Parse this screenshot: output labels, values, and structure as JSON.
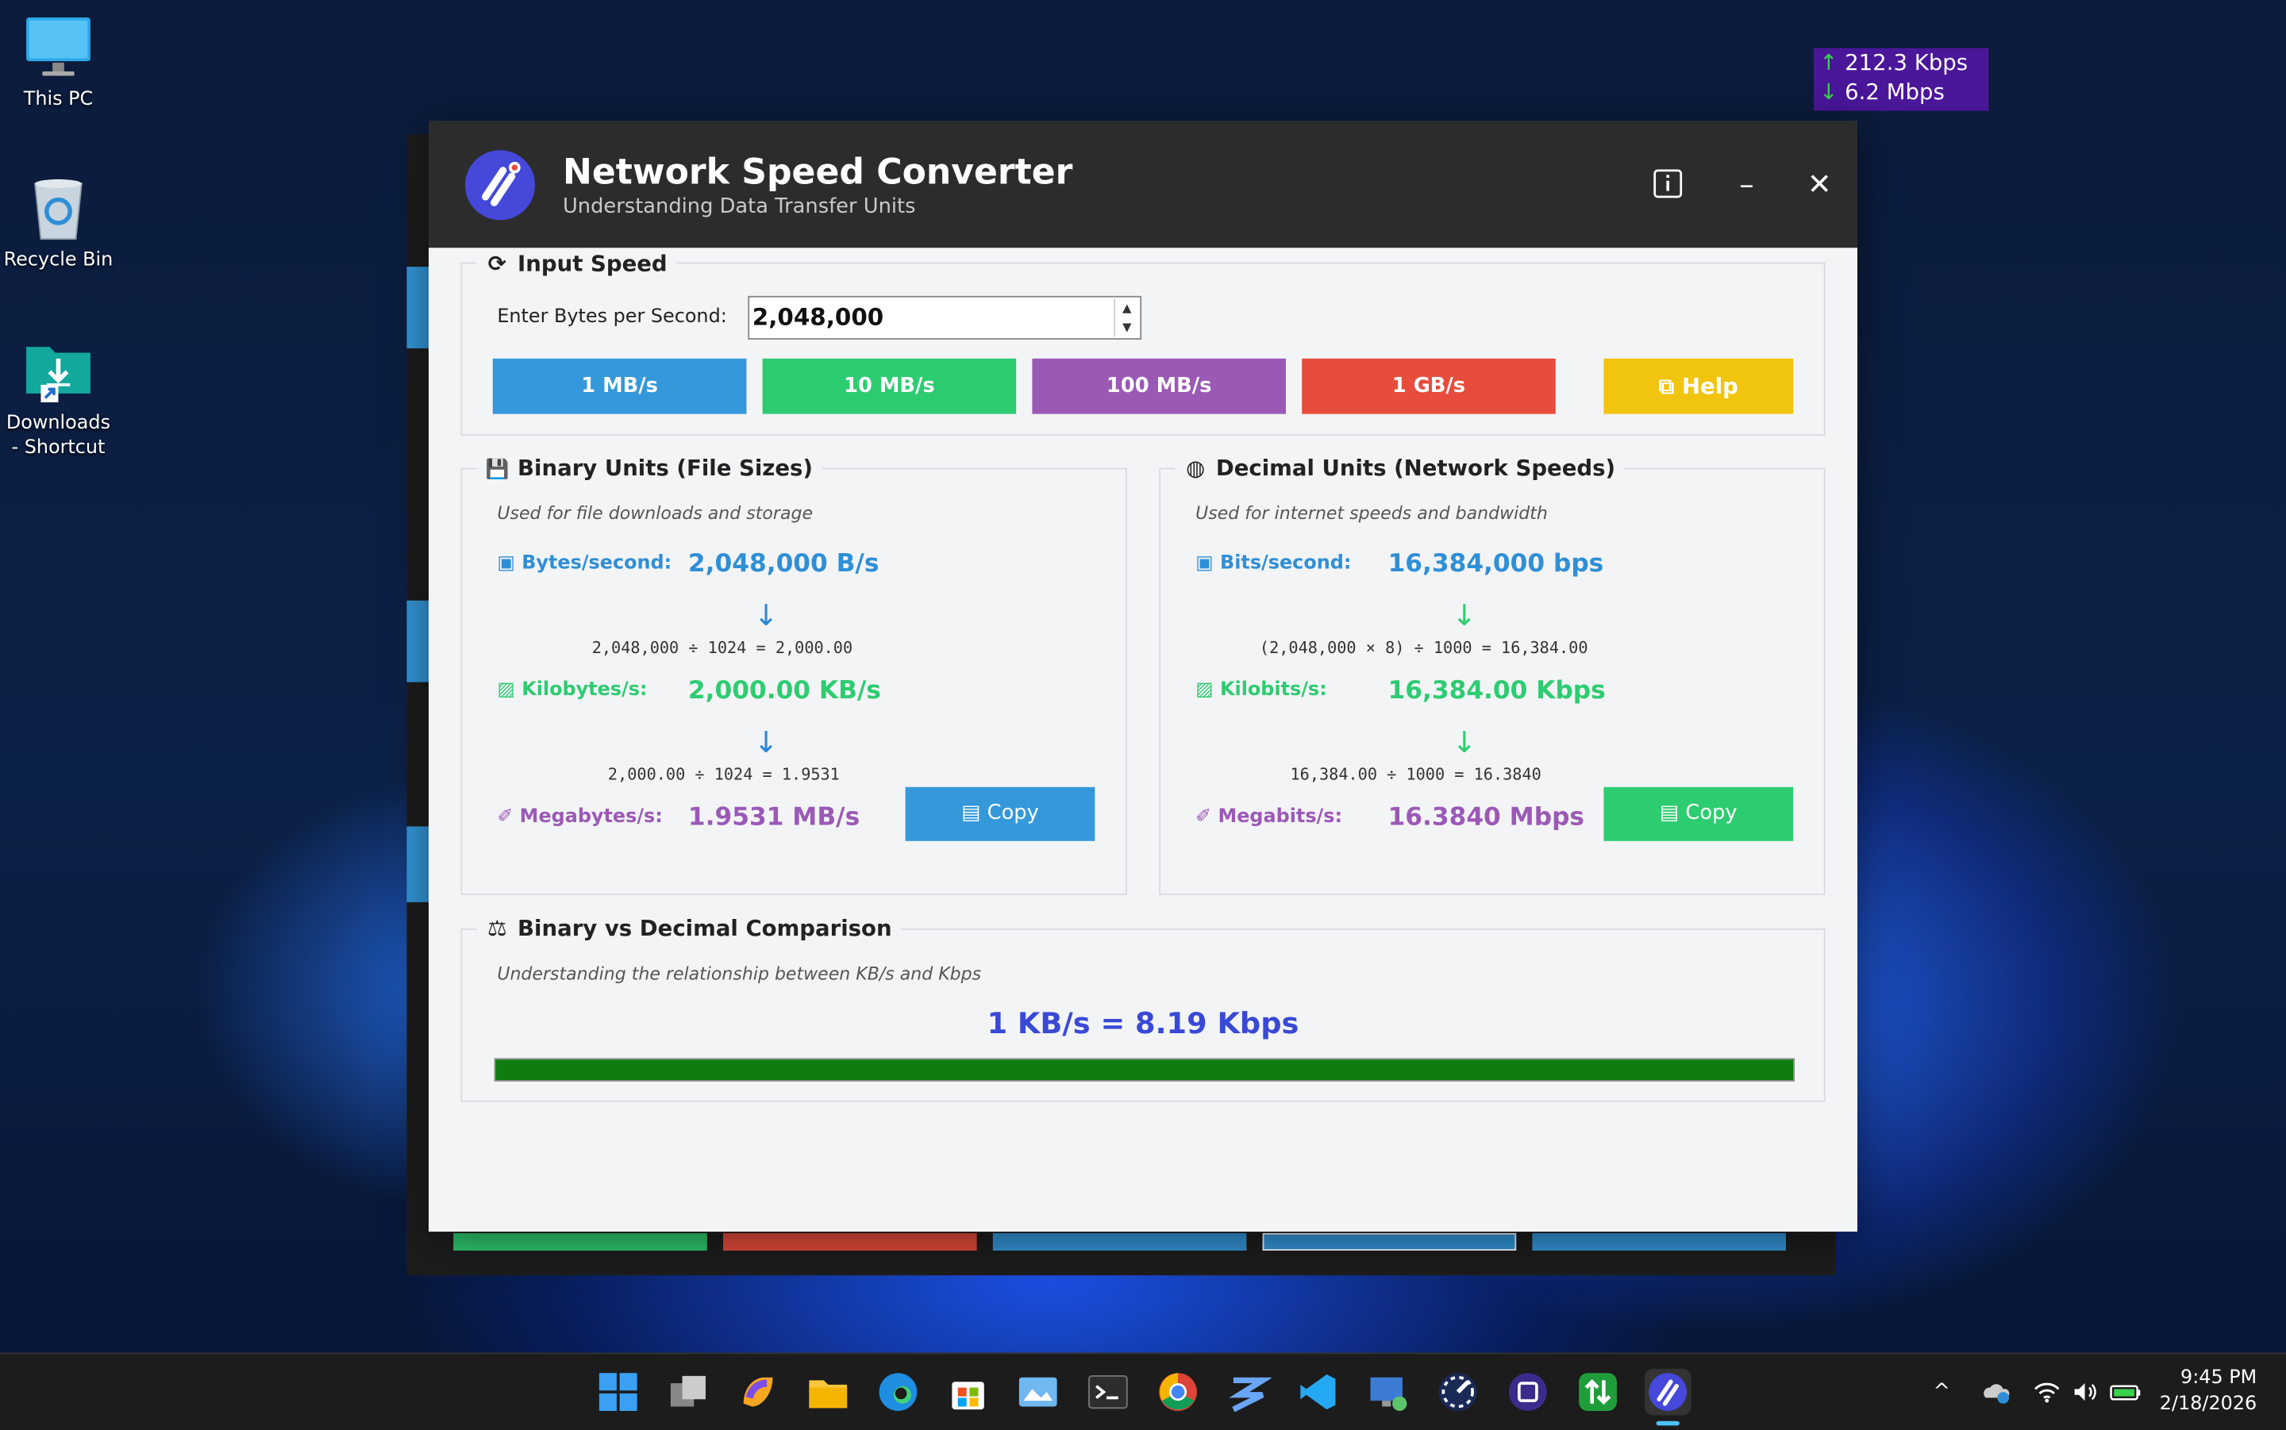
{
  "desktop": {
    "icons": [
      {
        "label": "This PC"
      },
      {
        "label": "Recycle Bin"
      },
      {
        "label": "Downloads - Shortcut"
      }
    ],
    "netmeter": {
      "upload": "212.3 Kbps",
      "download": "6.2 Mbps",
      "up_arrow": "↑",
      "down_arrow": "↓"
    }
  },
  "window": {
    "title": "Network Speed Converter",
    "subtitle": "Understanding Data Transfer Units",
    "info_icon": "ⓘ",
    "minimize_icon": "–",
    "close_icon": "✕"
  },
  "input_speed": {
    "title": "Input Speed",
    "icon": "⟳",
    "field_label": "Enter Bytes per Second:",
    "value": "2,048,000",
    "spin_up": "▲",
    "spin_down": "▼",
    "presets": [
      {
        "label": "1 MB/s",
        "color": "#3498db"
      },
      {
        "label": "10 MB/s",
        "color": "#2ecc71"
      },
      {
        "label": "100 MB/s",
        "color": "#9b59b6"
      },
      {
        "label": "1 GB/s",
        "color": "#e74c3c"
      }
    ],
    "help_label": "Help",
    "help_icon": "⧉",
    "help_color": "#f1c40f"
  },
  "binary": {
    "title": "Binary Units (File Sizes)",
    "icon": "💾",
    "hint": "Used for file downloads and storage",
    "rows": [
      {
        "label": "Bytes/second:",
        "value": "2,048,000 B/s",
        "color": "#2f8fd6",
        "icon": "▣"
      },
      {
        "label": "Kilobytes/s:",
        "value": "2,000.00 KB/s",
        "color": "#2ecc71",
        "icon": "▨"
      },
      {
        "label": "Megabytes/s:",
        "value": "1.9531 MB/s",
        "color": "#9b59b6",
        "icon": "✐"
      }
    ],
    "arrow": "↓",
    "formulas": [
      "2,048,000 ÷ 1024 = 2,000.00",
      "2,000.00 ÷ 1024 = 1.9531"
    ],
    "copy_label": "Copy",
    "copy_icon": "▤",
    "copy_color": "#3498db"
  },
  "decimal": {
    "title": "Decimal Units (Network Speeds)",
    "icon": "◍",
    "hint": "Used for internet speeds and bandwidth",
    "rows": [
      {
        "label": "Bits/second:",
        "value": "16,384,000 bps",
        "color": "#2f8fd6",
        "icon": "▣"
      },
      {
        "label": "Kilobits/s:",
        "value": "16,384.00 Kbps",
        "color": "#2ecc71",
        "icon": "▨"
      },
      {
        "label": "Megabits/s:",
        "value": "16.3840 Mbps",
        "color": "#9b59b6",
        "icon": "✐"
      }
    ],
    "arrow": "↓",
    "formulas": [
      "(2,048,000 × 8) ÷ 1000 = 16,384.00",
      "16,384.00 ÷ 1000 = 16.3840"
    ],
    "copy_label": "Copy",
    "copy_icon": "▤",
    "copy_color": "#2ecc71"
  },
  "comparison": {
    "title": "Binary vs Decimal Comparison",
    "icon": "⚖",
    "hint": "Understanding the relationship between KB/s and Kbps",
    "result": "1 KB/s = 8.19 Kbps",
    "progress_fraction": 1.0,
    "progress_color": "#107c10"
  },
  "taskbar": {
    "apps": [
      "start-icon",
      "task-view-icon",
      "copilot-icon",
      "file-explorer-icon",
      "edge-icon",
      "store-icon",
      "photos-icon",
      "terminal-icon",
      "chrome-icon",
      "app-icon",
      "vscode-icon",
      "remote-icon",
      "speed-icon",
      "network-app-icon",
      "transfer-icon",
      "network-speed-converter-icon"
    ],
    "tray_chevron": "^",
    "time": "9:45 PM",
    "date": "2/18/2026"
  }
}
